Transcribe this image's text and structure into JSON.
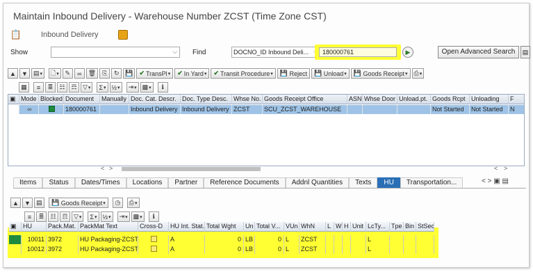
{
  "window": {
    "title": "Maintain Inbound Delivery - Warehouse Number ZCST (Time Zone CST)"
  },
  "app_toolbar": {
    "inbound_delivery_label": "Inbound Delivery"
  },
  "search": {
    "show_label": "Show",
    "show_value": "",
    "find_label": "Find",
    "find_field": "DOCNO_ID Inbound Deli...",
    "find_value": "180000761",
    "advanced_search_label": "Open Advanced Search"
  },
  "main_toolbar": {
    "transpl": "TransPl",
    "in_yard": "In Yard",
    "transit_procedure": "Transit Procedure",
    "reject": "Reject",
    "unload": "Unload",
    "goods_receipt": "Goods Receipt"
  },
  "delivery_table": {
    "columns": [
      "Mode",
      "Blocked",
      "Document",
      "Manually",
      "Doc. Cat. Descr.",
      "Doc. Type Desc.",
      "Whse No.",
      "Goods Receipt Office",
      "ASN",
      "Whse Door",
      "Unload.pt.",
      "Goods Rcpt",
      "Unloading",
      "F"
    ],
    "rows": [
      {
        "document": "180000761",
        "doc_cat": "Inbound Delivery",
        "doc_type": "Inbound Delivery",
        "whse": "ZCST",
        "gr_office": "SCU_ZCST_WAREHOUSE",
        "goods_rcpt": "Not Started",
        "unloading": "Not Started",
        "f": "N"
      }
    ]
  },
  "tabs": [
    "Items",
    "Status",
    "Dates/Times",
    "Locations",
    "Partner",
    "Reference Documents",
    "Addnl Quantities",
    "Texts",
    "HU",
    "Transportation..."
  ],
  "active_tab": "HU",
  "hu_toolbar": {
    "goods_receipt": "Goods Receipt"
  },
  "hu_table": {
    "columns": [
      "HU",
      "Pack.Mat.",
      "PackMat Text",
      "Cross-D",
      "HU Int. Stat.",
      "Total Wght",
      "Un",
      "Total V...",
      "VUn",
      "WhN",
      "L",
      "W",
      "H",
      "Unit",
      "LcTy...",
      "Tpe",
      "Bin",
      "StSec"
    ],
    "rows": [
      {
        "hu": "10011",
        "packmat": "3972",
        "packmat_text": "HU Packaging-ZCST",
        "int_stat": "A",
        "total_wght": "0",
        "un": "LB",
        "total_v": "0",
        "vun": "L",
        "whn": "ZCST",
        "lcty": "L"
      },
      {
        "hu": "10012",
        "packmat": "3972",
        "packmat_text": "HU Packaging-ZCST",
        "int_stat": "A",
        "total_wght": "0",
        "un": "LB",
        "total_v": "0",
        "vun": "L",
        "whn": "ZCST",
        "lcty": "L"
      }
    ]
  },
  "colors": {
    "highlight": "#ffff33",
    "selection": "#9ec3e6",
    "active_tab": "#2a6fb5"
  }
}
